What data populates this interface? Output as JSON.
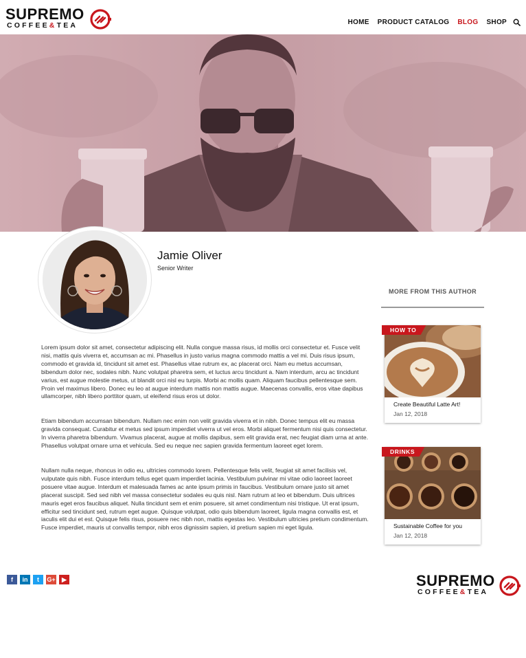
{
  "brand": {
    "name": "SUPREMO",
    "sub_left": "COFFEE",
    "sub_amp": "&",
    "sub_right": "TEA",
    "accent": "#c8171d"
  },
  "nav": {
    "items": [
      {
        "label": "HOME",
        "active": false
      },
      {
        "label": "PRODUCT CATALOG",
        "active": false
      },
      {
        "label": "BLOG",
        "active": true
      },
      {
        "label": "SHOP",
        "active": false
      }
    ],
    "search_icon": "search-icon"
  },
  "author": {
    "name": "Jamie Oliver",
    "role": "Senior Writer"
  },
  "article": {
    "paragraphs": [
      "Lorem ipsum dolor sit amet, consectetur adipiscing elit. Nulla congue massa risus, id mollis orci consectetur et. Fusce velit nisi, mattis quis viverra et, accumsan ac mi. Phasellus in justo varius magna commodo mattis a vel mi. Duis risus ipsum, commodo et gravida id, tincidunt sit amet est. Phasellus vitae rutrum ex, ac placerat orci. Nam eu metus accumsan, bibendum dolor nec, sodales nibh. Nunc volutpat pharetra sem, et luctus arcu tincidunt a. Nam interdum, arcu ac tincidunt varius, est augue molestie metus, ut blandit orci nisl eu turpis. Morbi ac mollis quam. Aliquam faucibus pellentesque sem. Proin vel maximus libero. Donec eu leo at augue interdum mattis non mattis augue. Maecenas convallis, eros vitae dapibus ullamcorper, nibh libero porttitor quam, ut eleifend risus eros ut dolor.",
      "Etiam bibendum accumsan bibendum. Nullam nec enim non velit gravida viverra et in nibh. Donec tempus elit eu massa gravida consequat. Curabitur et metus sed ipsum imperdiet viverra ut vel eros. Morbi aliquet fermentum nisi quis consectetur. In viverra pharetra bibendum. Vivamus placerat, augue at mollis dapibus, sem elit gravida erat, nec feugiat diam urna at ante. Phasellus volutpat ornare urna et vehicula. Sed eu neque nec sapien gravida fermentum laoreet eget lorem.",
      "Nullam nulla neque, rhoncus in odio eu, ultricies commodo lorem. Pellentesque felis velit, feugiat sit amet facilisis vel, vulputate quis nibh. Fusce interdum tellus eget quam imperdiet lacinia. Vestibulum pulvinar mi vitae odio laoreet laoreet posuere vitae augue. Interdum et malesuada fames ac ante ipsum primis in faucibus. Vestibulum ornare justo sit amet placerat suscipit. Sed sed nibh vel massa consectetur sodales eu quis nisl. Nam rutrum at leo et bibendum. Duis ultrices mauris eget eros faucibus aliquet. Nulla tincidunt sem et enim posuere, sit amet condimentum nisi tristique. Ut erat ipsum, efficitur sed tincidunt sed, rutrum eget augue. Quisque volutpat, odio quis bibendum laoreet, ligula magna convallis est, et iaculis elit dui et est. Quisque felis risus, posuere nec nibh non, mattis egestas leo. Vestibulum ultricies pretium condimentum. Fusce imperdiet, mauris ut convallis tempor, nibh eros dignissim sapien, id pretium sapien mi eget ligula."
    ]
  },
  "sidebar": {
    "title": "MORE FROM THIS AUTHOR",
    "cards": [
      {
        "tag": "HOW TO",
        "title": "Create Beautiful Latte Art!",
        "date": "Jan 12, 2018"
      },
      {
        "tag": "DRINKS",
        "title": "Sustainable Coffee for you",
        "date": "Jan 12, 2018"
      }
    ]
  },
  "social": [
    {
      "icon": "facebook-icon",
      "glyph": "f",
      "color": "#3b5998"
    },
    {
      "icon": "linkedin-icon",
      "glyph": "in",
      "color": "#0077b5"
    },
    {
      "icon": "twitter-icon",
      "glyph": "t",
      "color": "#1da1f2"
    },
    {
      "icon": "google-plus-icon",
      "glyph": "G+",
      "color": "#dd4b39"
    },
    {
      "icon": "youtube-icon",
      "glyph": "▶",
      "color": "#cd201f"
    }
  ]
}
